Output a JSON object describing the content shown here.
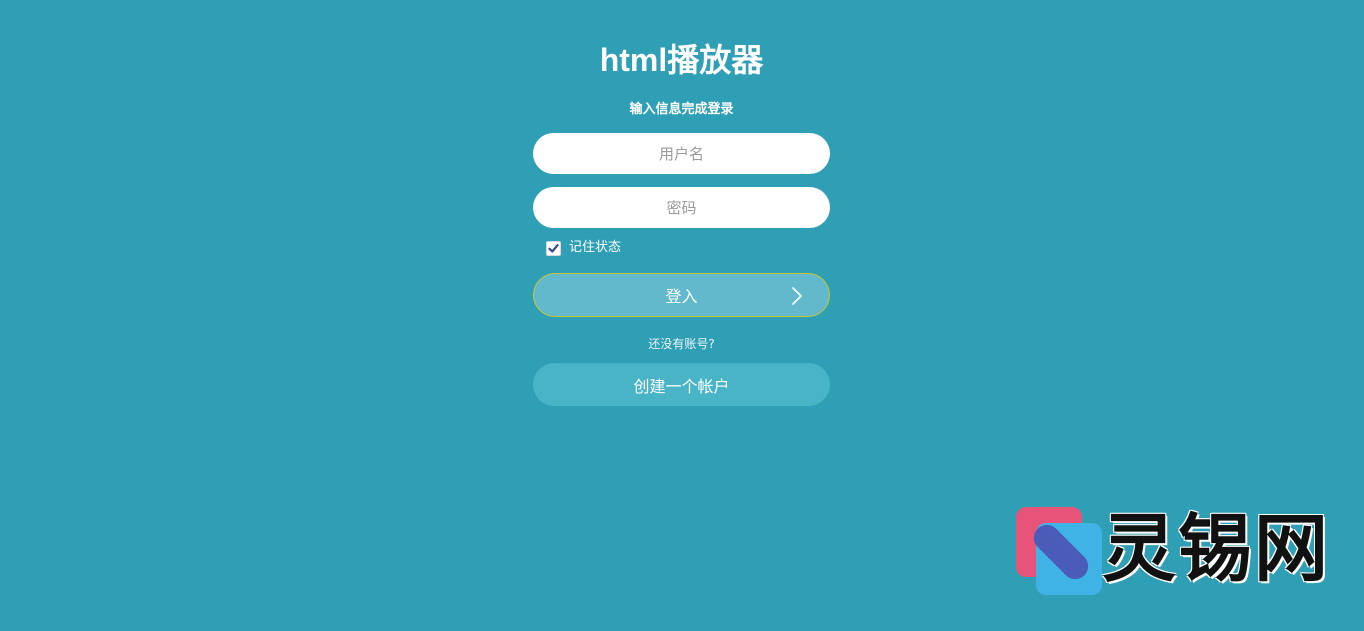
{
  "app": {
    "title": "html播放器",
    "subtitle": "输入信息完成登录"
  },
  "form": {
    "username_placeholder": "用户名",
    "password_placeholder": "密码",
    "remember_label": "记住状态",
    "remember_checked": true,
    "login_label": "登入",
    "no_account_text": "还没有账号?",
    "create_account_label": "创建一个帐户"
  },
  "icons": {
    "checkbox": "checkmark-icon",
    "login_arrow": "chevron-right-icon",
    "watermark_logo": "lingxi-logo-icon"
  },
  "watermark": {
    "text": "灵锡网"
  },
  "colors": {
    "background": "#2e9fb5",
    "login_button": "#62b9cb",
    "login_border": "#c9c530",
    "create_button": "#4ab4c7",
    "checkbox_mark": "#3a4a8a"
  }
}
